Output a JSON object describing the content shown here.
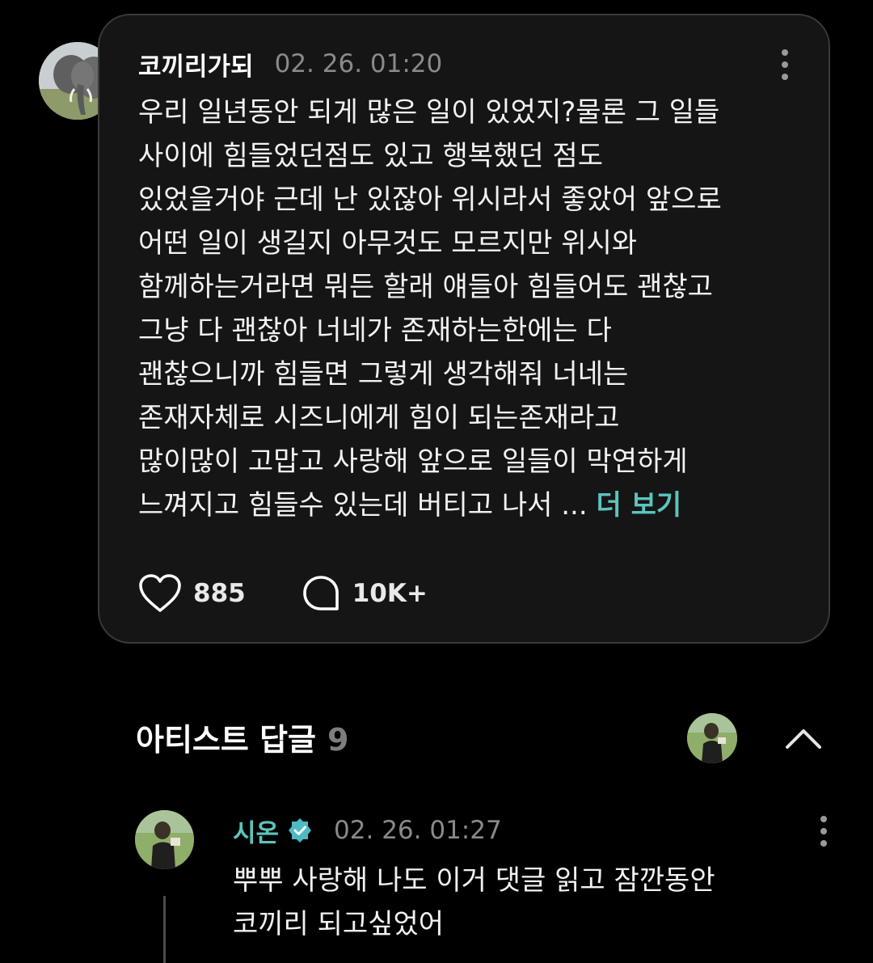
{
  "post": {
    "author": "코끼리가되",
    "timestamp": "02. 26. 01:20",
    "lines": [
      "우리 일년동안 되게 많은 일이 있었지?물론 그 일들",
      "사이에 힘들었던점도 있고 행복했던 점도",
      "있었을거야 근데 난 있잖아 위시라서 좋았어 앞으로",
      "어떤 일이 생길지 아무것도 모르지만 위시와",
      "함께하는거라면 뭐든 할래 얘들아 힘들어도 괜찮고",
      "그냥 다 괜찮아 너네가 존재하는한에는 다",
      "괜찮으니까 힘들면 그렇게 생각해줘 너네는",
      "존재자체로 시즈니에게 힘이 되는존재라고",
      "많이많이 고맙고 사랑해 앞으로 일들이 막연하게"
    ],
    "last_line": "느껴지고 힘들수 있는데 버티고 나서 ...",
    "more_label": "더 보기",
    "like_count": "885",
    "comment_count": "10K+",
    "avatar_icon": "elephant-avatar",
    "like_icon": "heart-outline-icon",
    "comment_icon": "speech-bubble-icon",
    "menu_icon": "more-vertical-icon"
  },
  "artist_replies": {
    "title": "아티스트 답글",
    "count": "9",
    "collapse_icon": "chevron-up-icon"
  },
  "reply": {
    "author": "시온",
    "verified_icon": "verified-badge-icon",
    "timestamp": "02. 26. 01:27",
    "lines": [
      "뿌뿌 사랑해 나도 이거 댓글 읽고 잠깐동안",
      "코끼리 되고싶었어"
    ],
    "menu_icon": "more-vertical-icon"
  },
  "colors": {
    "background": "#000000",
    "card": "#151515",
    "card_border": "#3a3a3a",
    "accent": "#5cc4bd",
    "muted": "#8a8a8a",
    "text": "#f2f2f2"
  }
}
